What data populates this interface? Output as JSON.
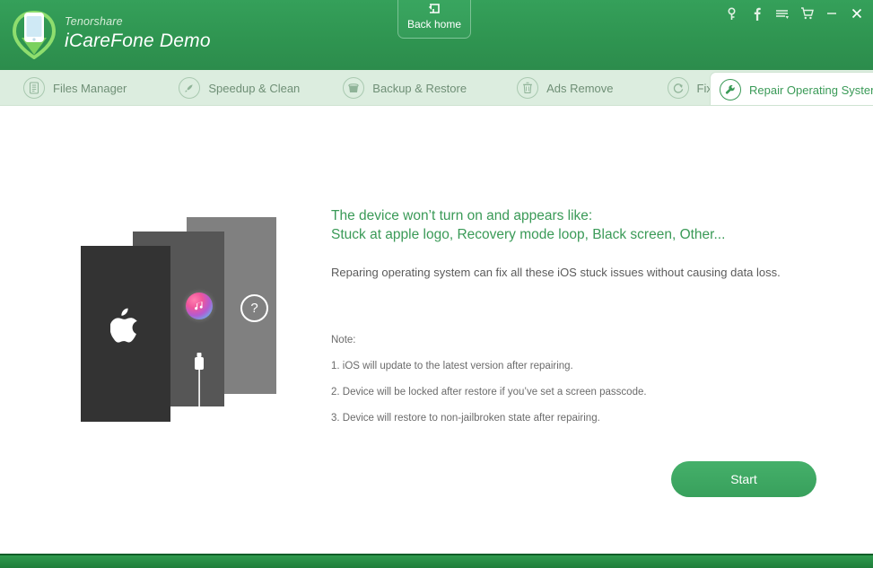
{
  "header": {
    "brand_sub": "Tenorshare",
    "brand_title": "iCareFone Demo",
    "logo_icon": "icarefone-shield-phone-logo",
    "back_home": {
      "label": "Back home",
      "icon": "back-home-arrow-icon"
    },
    "window_buttons": [
      {
        "name": "key-icon",
        "glyph": "⚷"
      },
      {
        "name": "facebook-icon",
        "glyph": "f"
      },
      {
        "name": "menu-icon",
        "glyph": "≡"
      },
      {
        "name": "cart-icon",
        "glyph": "Ὥ2"
      },
      {
        "name": "minimize-icon",
        "glyph": "—"
      },
      {
        "name": "close-icon",
        "glyph": "✕"
      }
    ],
    "colors": {
      "green": "#2f9551",
      "green_light": "#35a05a"
    }
  },
  "tabs": [
    {
      "label": "Files Manager",
      "icon": "document-list-icon",
      "active": false
    },
    {
      "label": "Speedup & Clean",
      "icon": "rocket-icon",
      "active": false
    },
    {
      "label": "Backup & Restore",
      "icon": "bucket-icon",
      "active": false
    },
    {
      "label": "Ads Remove",
      "icon": "trash-icon",
      "active": false
    },
    {
      "label": "Fix iOS Stuck",
      "icon": "refresh-icon",
      "active": false
    },
    {
      "label": "Repair Operating System",
      "icon": "wrench-icon",
      "active": true
    }
  ],
  "main": {
    "headline_line1": "The device won’t turn on and appears like:",
    "headline_line2": "Stuck at apple logo, Recovery mode loop, Black screen, Other...",
    "subcopy": "Reparing operating system can fix all these iOS stuck issues without causing data loss.",
    "note_title": "Note:",
    "notes": [
      "1. iOS will update to the latest version after repairing.",
      "2. Device will be locked after restore if you’ve set a screen passcode.",
      "3. Device will restore to non-jailbroken state after repairing."
    ],
    "start_label": "Start",
    "illustration": {
      "screen_back_icon": "question-mark-icon",
      "screen_mid_icon": "itunes-icon",
      "screen_mid_icon_2": "lightning-cable-icon",
      "screen_front_icon": "apple-logo-icon",
      "colors": {
        "front": "#333333",
        "middle": "#565656",
        "back": "#808080"
      }
    }
  }
}
